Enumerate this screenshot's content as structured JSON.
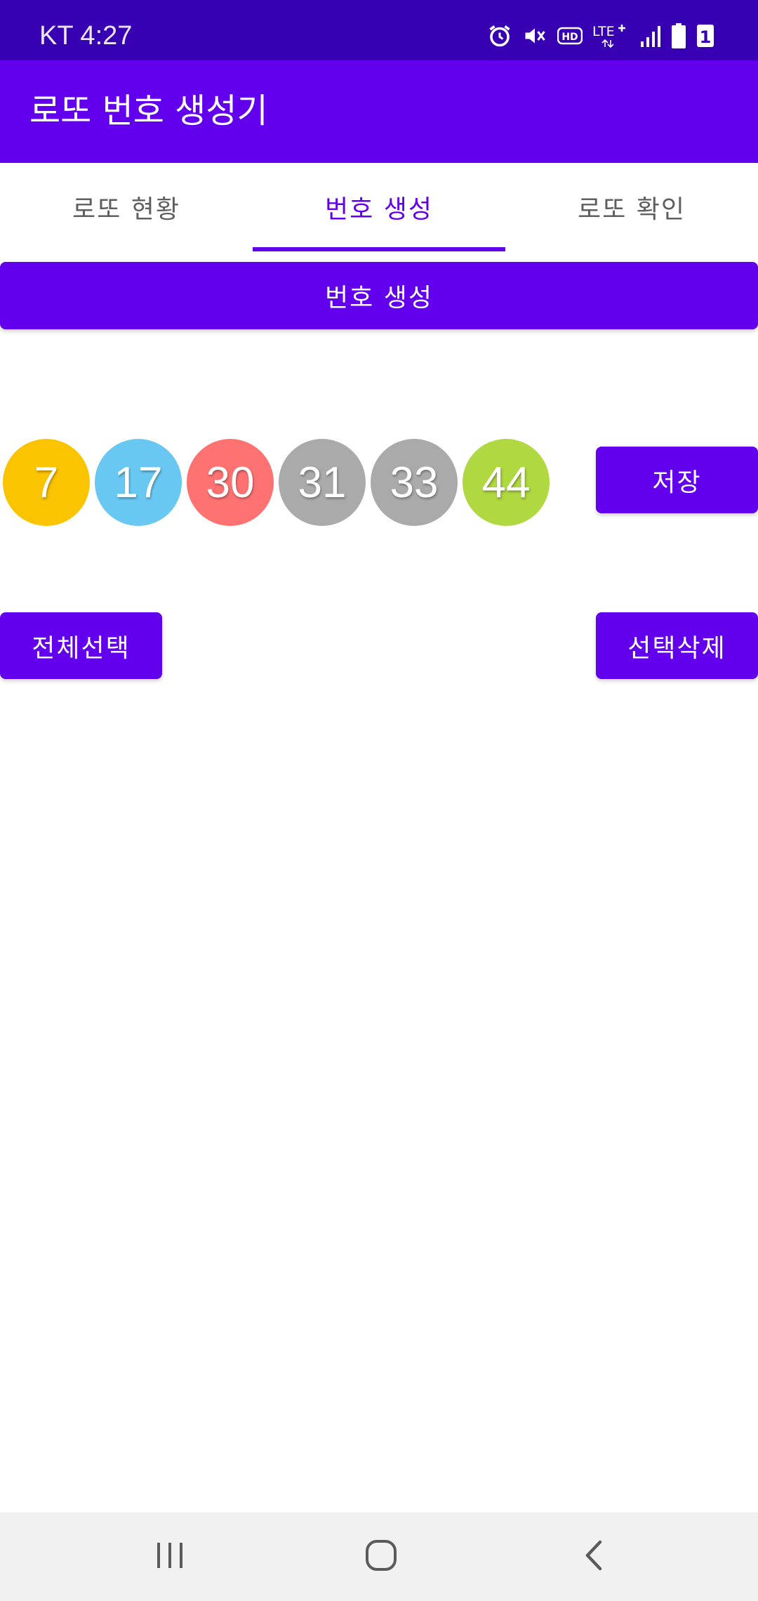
{
  "status_bar": {
    "carrier_time": "KT 4:27",
    "icons": [
      "alarm-icon",
      "mute-icon",
      "hd-icon",
      "lte-plus-icon",
      "signal-icon",
      "battery-icon",
      "sim-1-icon"
    ],
    "hd_label": "HD",
    "lte_label": "LTE",
    "sim_label": "1"
  },
  "app_bar": {
    "title": "로또 번호 생성기"
  },
  "tabs": [
    {
      "label": "로또 현황",
      "active": false
    },
    {
      "label": "번호 생성",
      "active": true
    },
    {
      "label": "로또 확인",
      "active": false
    }
  ],
  "actions": {
    "generate_label": "번호 생성",
    "save_label": "저장",
    "select_all_label": "전체선택",
    "delete_selected_label": "선택삭제"
  },
  "balls": [
    {
      "number": "7",
      "color": "#fbc400"
    },
    {
      "number": "17",
      "color": "#69c8f2"
    },
    {
      "number": "30",
      "color": "#ff7272"
    },
    {
      "number": "31",
      "color": "#aaaaaa"
    },
    {
      "number": "33",
      "color": "#aaaaaa"
    },
    {
      "number": "44",
      "color": "#b0d840"
    }
  ],
  "nav_bar": {
    "icons": [
      "recent-apps-icon",
      "home-icon",
      "back-icon"
    ]
  },
  "colors": {
    "status_bar": "#3700b3",
    "primary": "#6200ee",
    "nav_bar": "#f1f1f1"
  }
}
